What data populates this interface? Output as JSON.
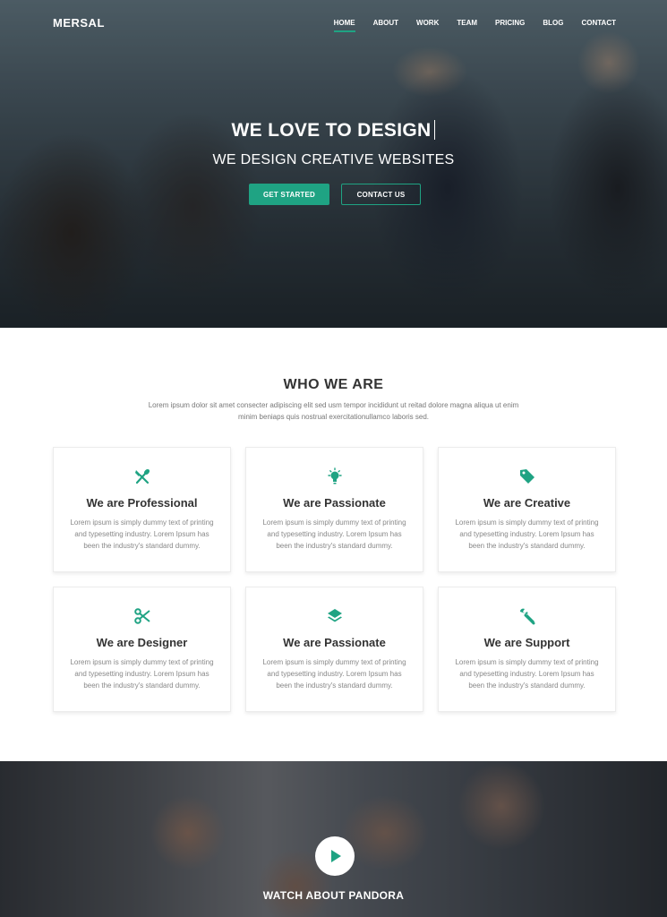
{
  "brand": "MERSAL",
  "nav": [
    {
      "label": "HOME",
      "active": true
    },
    {
      "label": "ABOUT"
    },
    {
      "label": "WORK"
    },
    {
      "label": "TEAM"
    },
    {
      "label": "PRICING"
    },
    {
      "label": "BLOG"
    },
    {
      "label": "CONTACT"
    }
  ],
  "hero": {
    "title_prefix": "WE LOVE TO ",
    "title_strong": "DESIGN",
    "subtitle": "WE DESIGN CREATIVE WEBSITES",
    "primary_button": "GET STARTED",
    "secondary_button": "CONTACT US"
  },
  "about": {
    "title": "WHO WE ARE",
    "description": "Lorem ipsum dolor sit amet consecter adipiscing elit sed usm tempor incididunt ut reitad dolore magna aliqua ut enim minim beniaps quis nostrual exercitationullamco laboris sed.",
    "cards": [
      {
        "title": "We are Professional",
        "icon": "cutlery-icon",
        "text": "Lorem ipsum is simply dummy text of printing and typesetting industry. Lorem Ipsum has been the industry's standard dummy."
      },
      {
        "title": "We are Passionate",
        "icon": "lightbulb-icon",
        "text": "Lorem ipsum is simply dummy text of printing and typesetting industry. Lorem Ipsum has been the industry's standard dummy."
      },
      {
        "title": "We are Creative",
        "icon": "tag-icon",
        "text": "Lorem ipsum is simply dummy text of printing and typesetting industry. Lorem Ipsum has been the industry's standard dummy."
      },
      {
        "title": "We are Designer",
        "icon": "scissors-icon",
        "text": "Lorem ipsum is simply dummy text of printing and typesetting industry. Lorem Ipsum has been the industry's standard dummy."
      },
      {
        "title": "We are Passionate",
        "icon": "layers-icon",
        "text": "Lorem ipsum is simply dummy text of printing and typesetting industry. Lorem Ipsum has been the industry's standard dummy."
      },
      {
        "title": "We are Support",
        "icon": "wrench-icon",
        "text": "Lorem ipsum is simply dummy text of printing and typesetting industry. Lorem Ipsum has been the industry's standard dummy."
      }
    ]
  },
  "video": {
    "title": "WATCH ABOUT PANDORA",
    "icon": "play-icon"
  },
  "colors": {
    "accent": "#1fa383"
  }
}
